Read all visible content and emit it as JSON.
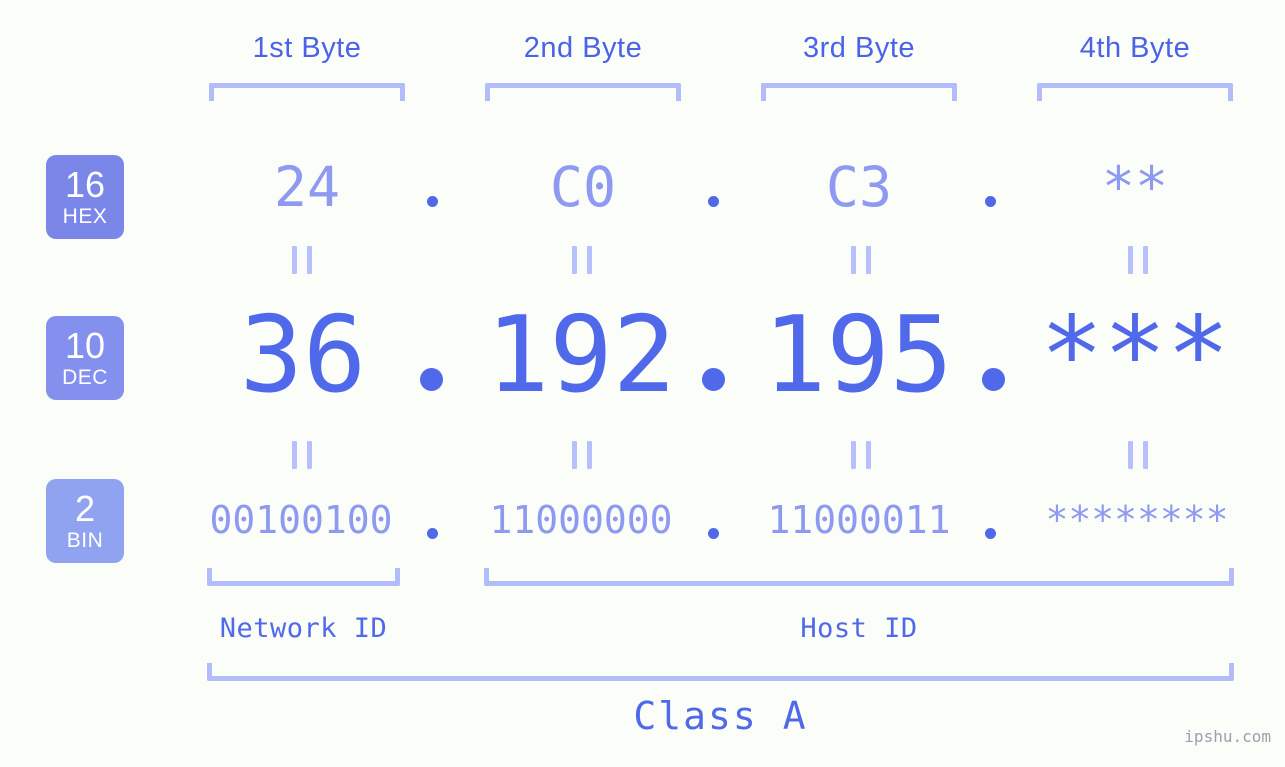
{
  "page": {
    "background_color": "#fbfdf8",
    "accent_color": "#5068ea",
    "muted_accent_color": "#8e99f2",
    "bracket_color": "#b3bcfb",
    "watermark": "ipshu.com"
  },
  "byte_headers": [
    {
      "label": "1st Byte"
    },
    {
      "label": "2nd Byte"
    },
    {
      "label": "3rd Byte"
    },
    {
      "label": "4th Byte"
    }
  ],
  "bases": [
    {
      "radix": "16",
      "name": "HEX",
      "color": "#7b86e9"
    },
    {
      "radix": "10",
      "name": "DEC",
      "color": "#8490ee"
    },
    {
      "radix": "2",
      "name": "BIN",
      "color": "#8fa3f1"
    }
  ],
  "rows": {
    "hex": {
      "base_radix": "16",
      "base_name": "HEX",
      "octets": [
        "24",
        "C0",
        "C3",
        "**"
      ],
      "separator": "."
    },
    "dec": {
      "base_radix": "10",
      "base_name": "DEC",
      "octets": [
        "36",
        "192",
        "195",
        "***"
      ],
      "separator": "."
    },
    "bin": {
      "base_radix": "2",
      "base_name": "BIN",
      "octets": [
        "00100100",
        "11000000",
        "11000011",
        "********"
      ],
      "separator": "."
    }
  },
  "equality_marks": {
    "symbol": "=",
    "count_per_gap": 4,
    "gaps": 2
  },
  "segments": {
    "network_id": "Network ID",
    "host_id": "Host ID",
    "class": "Class A"
  },
  "chart_data": {
    "type": "table",
    "title": "IPv4 Address Byte Breakdown",
    "ip_address_decimal": "36.192.195.***",
    "ip_address_hex": "24.C0.C3.**",
    "ip_address_binary": "00100100.11000000.11000011.********",
    "address_class": "Class A",
    "network_id_bytes": [
      1
    ],
    "host_id_bytes": [
      2,
      3,
      4
    ],
    "columns": [
      "1st Byte",
      "2nd Byte",
      "3rd Byte",
      "4th Byte"
    ],
    "rows": [
      {
        "base": "16",
        "name": "HEX",
        "values": [
          "24",
          "C0",
          "C3",
          "**"
        ]
      },
      {
        "base": "10",
        "name": "DEC",
        "values": [
          "36",
          "192",
          "195",
          "***"
        ]
      },
      {
        "base": "2",
        "name": "BIN",
        "values": [
          "00100100",
          "11000000",
          "11000011",
          "********"
        ]
      }
    ]
  }
}
